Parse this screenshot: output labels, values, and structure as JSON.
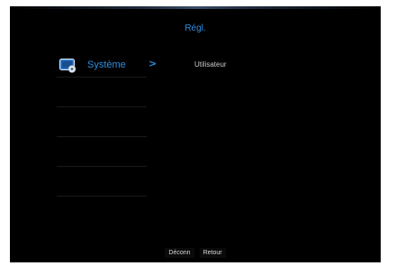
{
  "header": {
    "title": "Régl."
  },
  "sidebar": {
    "items": [
      {
        "label": "Système",
        "icon": "system-settings-icon",
        "selected": true
      },
      {
        "label": ""
      },
      {
        "label": ""
      },
      {
        "label": ""
      },
      {
        "label": ""
      }
    ]
  },
  "submenu": {
    "items": [
      {
        "label": "Utilisateur"
      }
    ]
  },
  "footer": {
    "logout_label": "Déconn",
    "back_label": "Retour"
  },
  "colors": {
    "accent": "#2e8fe0",
    "background": "#000000",
    "text": "#c8c8c8"
  }
}
